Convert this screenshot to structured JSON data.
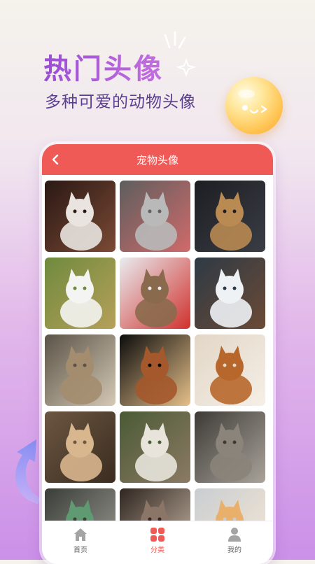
{
  "promo": {
    "headline": "热门头像",
    "subheadline": "多种可爱的动物头像"
  },
  "phone": {
    "title": "宠物头像",
    "header_color": "#f05a56",
    "back_icon": "chevron-left-icon"
  },
  "grid": {
    "columns": 3,
    "photos": [
      {
        "subject": "white kitten on basket",
        "colors": [
          "#2a1814",
          "#e9e4e0",
          "#7b4a35"
        ]
      },
      {
        "subject": "tabby cat licking, grayscale",
        "colors": [
          "#5e5e5e",
          "#b9b9b9",
          "#d06a6a"
        ]
      },
      {
        "subject": "bengal kitten on dark blanket",
        "colors": [
          "#1c1e23",
          "#b98a52",
          "#3a3d44"
        ]
      },
      {
        "subject": "white spitz dog on grass",
        "colors": [
          "#6f8a3d",
          "#f4f4f2",
          "#b6a05a"
        ]
      },
      {
        "subject": "tabby cat with red scarf",
        "colors": [
          "#e9ecf0",
          "#8a6a4c",
          "#d0312d"
        ]
      },
      {
        "subject": "dog running in snow",
        "colors": [
          "#2e3a45",
          "#eef2f5",
          "#6b4a36"
        ]
      },
      {
        "subject": "two cats hugging",
        "colors": [
          "#5b5347",
          "#a48d6f",
          "#d4c9b5"
        ]
      },
      {
        "subject": "brown dog jumping, dark background",
        "colors": [
          "#0c0c0c",
          "#a4582b",
          "#e6c08a"
        ]
      },
      {
        "subject": "fluffy sheltie dog",
        "colors": [
          "#e2d6c6",
          "#b7672b",
          "#f5efe7"
        ]
      },
      {
        "subject": "tabby cat face close-up",
        "colors": [
          "#6c5641",
          "#d8b68e",
          "#3a2c20"
        ]
      },
      {
        "subject": "white and tabby cat side profile",
        "colors": [
          "#4a5a35",
          "#e8e4dc",
          "#8c7a64"
        ]
      },
      {
        "subject": "tabby kitten on wooden floor",
        "colors": [
          "#3d3a36",
          "#8a847a",
          "#a9a39a"
        ]
      },
      {
        "subject": "green cat eye close-up",
        "colors": [
          "#3a3e38",
          "#5f9a72",
          "#9c9b93"
        ]
      },
      {
        "subject": "cat peeking",
        "colors": [
          "#2f2620",
          "#8b7566",
          "#c9b7a5"
        ]
      },
      {
        "subject": "sleeping orange cat",
        "colors": [
          "#c9cdd2",
          "#e9b06b",
          "#f5e7d3"
        ]
      }
    ]
  },
  "tabbar": {
    "items": [
      {
        "label": "首页",
        "icon": "home-icon",
        "active": false
      },
      {
        "label": "分类",
        "icon": "grid-icon",
        "active": true
      },
      {
        "label": "我的",
        "icon": "user-icon",
        "active": false
      }
    ]
  },
  "colors": {
    "accent": "#f05a56",
    "headline_purple": "#9a4fd2",
    "subhead_purple": "#5b3f8f",
    "inactive_icon": "#a4a4a4"
  }
}
